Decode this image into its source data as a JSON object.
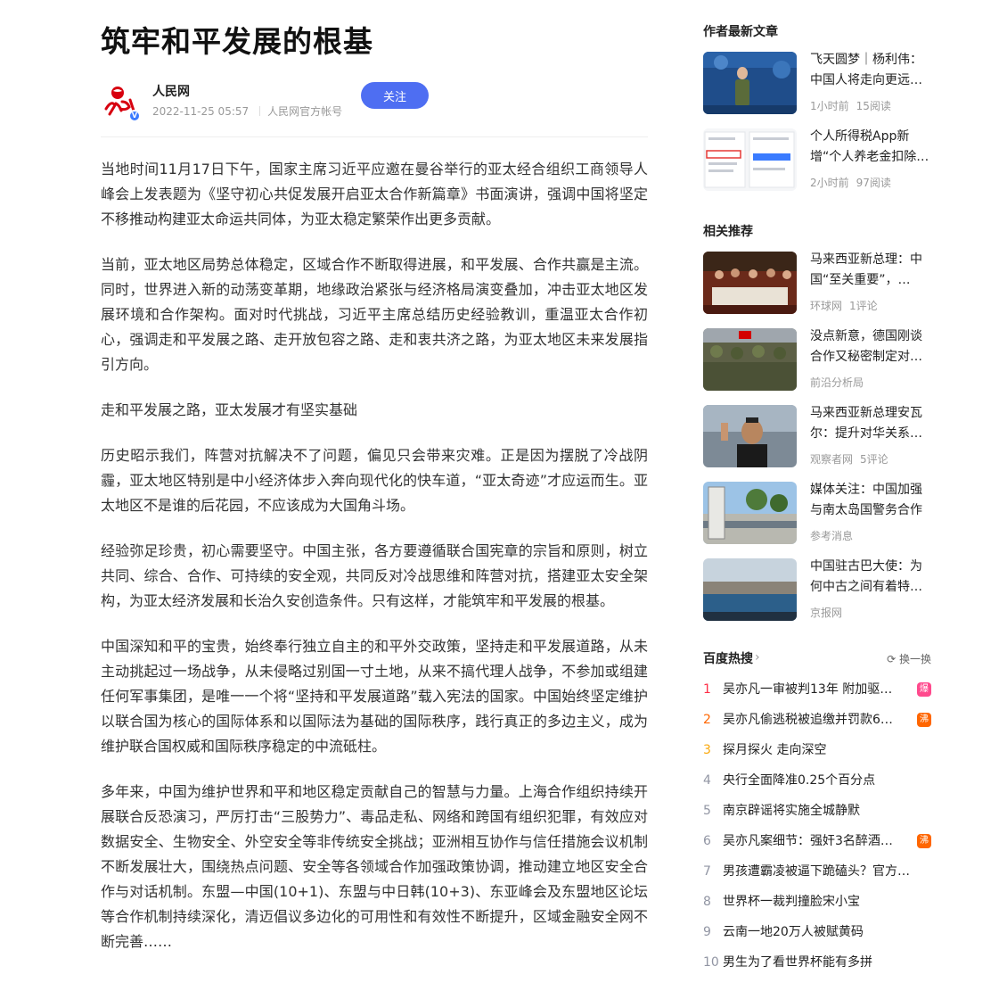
{
  "article": {
    "title": "筑牢和平发展的根基",
    "author": {
      "name": "人民网",
      "date": "2022-11-25 05:57",
      "account": "人民网官方帐号",
      "follow_label": "关注"
    },
    "paragraphs": [
      "当地时间11月17日下午，国家主席习近平应邀在曼谷举行的亚太经合组织工商领导人峰会上发表题为《坚守初心共促发展开启亚太合作新篇章》书面演讲，强调中国将坚定不移推动构建亚太命运共同体，为亚太稳定繁荣作出更多贡献。",
      "当前，亚太地区局势总体稳定，区域合作不断取得进展，和平发展、合作共赢是主流。同时，世界进入新的动荡变革期，地缘政治紧张与经济格局演变叠加，冲击亚太地区发展环境和合作架构。面对时代挑战，习近平主席总结历史经验教训，重温亚太合作初心，强调走和平发展之路、走开放包容之路、走和衷共济之路，为亚太地区未来发展指引方向。",
      "走和平发展之路，亚太发展才有坚实基础",
      "历史昭示我们，阵营对抗解决不了问题，偏见只会带来灾难。正是因为摆脱了冷战阴霾，亚太地区特别是中小经济体步入奔向现代化的快车道，“亚太奇迹”才应运而生。亚太地区不是谁的后花园，不应该成为大国角斗场。",
      "经验弥足珍贵，初心需要坚守。中国主张，各方要遵循联合国宪章的宗旨和原则，树立共同、综合、合作、可持续的安全观，共同反对冷战思维和阵营对抗，搭建亚太安全架构，为亚太经济发展和长治久安创造条件。只有这样，才能筑牢和平发展的根基。",
      "中国深知和平的宝贵，始终奉行独立自主的和平外交政策，坚持走和平发展道路，从未主动挑起过一场战争，从未侵略过别国一寸土地，从来不搞代理人战争，不参加或组建任何军事集团，是唯一一个将“坚持和平发展道路”载入宪法的国家。中国始终坚定维护以联合国为核心的国际体系和以国际法为基础的国际秩序，践行真正的多边主义，成为维护联合国权威和国际秩序稳定的中流砥柱。",
      "多年来，中国为维护世界和平和地区稳定贡献自己的智慧与力量。上海合作组织持续开展联合反恐演习，严厉打击“三股势力”、毒品走私、网络和跨国有组织犯罪，有效应对数据安全、生物安全、外空安全等非传统安全挑战；亚洲相互协作与信任措施会议机制不断发展壮大，围绕热点问题、安全等各领域合作加强政策协调，推动建立地区安全合作与对话机制。东盟—中国(10+1)、东盟与中日韩(10+3)、东亚峰会及东盟地区论坛等合作机制持续深化，清迈倡议多边化的可用性和有效性不断提升，区域金融安全网不断完善……"
    ]
  },
  "sidebar": {
    "latest_title": "作者最新文章",
    "latest": [
      {
        "title": "飞天圆梦｜杨利伟：中国人将走向更远…",
        "time": "1小时前",
        "reads": "15阅读"
      },
      {
        "title": "个人所得税App新增“个人养老金扣除…",
        "time": "2小时前",
        "reads": "97阅读"
      }
    ],
    "related_title": "相关推荐",
    "related": [
      {
        "title": "马来西亚新总理：中国“至关重要”，…",
        "source": "环球网",
        "extra": "1评论"
      },
      {
        "title": "没点新意，德国刚谈合作又秘密制定对…",
        "source": "前沿分析局",
        "extra": ""
      },
      {
        "title": "马来西亚新总理安瓦尔：提升对华关系…",
        "source": "观察者网",
        "extra": "5评论"
      },
      {
        "title": "媒体关注：中国加强与南太岛国警务合作",
        "source": "参考消息",
        "extra": ""
      },
      {
        "title": "中国驻古巴大使：为何中古之间有着特…",
        "source": "京报网",
        "extra": ""
      }
    ],
    "hot": {
      "brand": "百度热搜",
      "refresh_label": "换一换",
      "items": [
        {
          "rank": "1",
          "text": "吴亦凡一审被判13年 附加驱…",
          "badge": "爆",
          "badge_color": "#ff4a8d"
        },
        {
          "rank": "2",
          "text": "吴亦凡偷逃税被追缴并罚款6…",
          "badge": "沸",
          "badge_color": "#ff6600"
        },
        {
          "rank": "3",
          "text": "探月探火 走向深空",
          "badge": "",
          "badge_color": ""
        },
        {
          "rank": "4",
          "text": "央行全面降准0.25个百分点",
          "badge": "",
          "badge_color": ""
        },
        {
          "rank": "5",
          "text": "南京辟谣将实施全城静默",
          "badge": "",
          "badge_color": ""
        },
        {
          "rank": "6",
          "text": "吴亦凡案细节：强奸3名醉酒…",
          "badge": "沸",
          "badge_color": "#ff6600"
        },
        {
          "rank": "7",
          "text": "男孩遭霸凌被逼下跪磕头？官方…",
          "badge": "",
          "badge_color": ""
        },
        {
          "rank": "8",
          "text": "世界杯一裁判撞脸宋小宝",
          "badge": "",
          "badge_color": ""
        },
        {
          "rank": "9",
          "text": "云南一地20万人被赋黄码",
          "badge": "",
          "badge_color": ""
        },
        {
          "rank": "10",
          "text": "男生为了看世界杯能有多拼",
          "badge": "",
          "badge_color": ""
        }
      ]
    }
  }
}
